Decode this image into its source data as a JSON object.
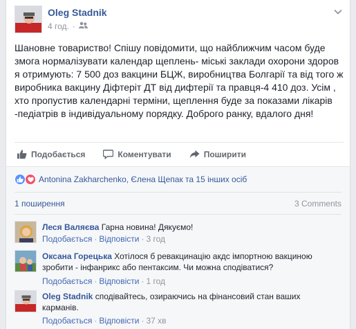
{
  "post": {
    "author": "Oleg Stadnik",
    "time": "4 год.",
    "separator": "·",
    "text": "Шановне товариство! Спішу повідомити, що найближчим часом буде змога нормалізувати календар щеплень- міські заклади охорони здоров я отримують: 7 500 доз вакцини БЦЖ, виробництва Болгарії та від того ж виробника вакцину Діфтеріт ДТ від дифтерії та правця-4 410 доз. Усім , хто пропустив календарні терміни, щеплення буде за показами лікарів -педіатрів в індивідуальному порядку. Доброго ранку, вдалого дня!",
    "actions": {
      "like": "Подобається",
      "comment": "Коментувати",
      "share": "Поширити"
    }
  },
  "ufi": {
    "reactions_text": "Antonina Zakharchenko, Єлена Щепак та 15 інших осіб",
    "shares_text": "1 поширення",
    "comments_count": "3 Comments"
  },
  "comments": [
    {
      "author": "Леся Валяєва",
      "text": "Гарна новина! Дякуємо!",
      "like": "Подобається",
      "reply": "Відповісти",
      "time": "3 год"
    },
    {
      "author": "Оксана Горецька",
      "text": "Хотілося б ревакцинацію акдс імпортною вакциною зробити - інфанрикс або пентаксим. Чи можна сподіватися?",
      "like": "Подобається",
      "reply": "Відповісти",
      "time": "1 год"
    },
    {
      "author": "Oleg Stadnik",
      "text": "сподівайтесь, озираючись на фінансовий стан ваших карманів.",
      "like": "Подобається",
      "reply": "Відповісти",
      "time": "37 хв"
    }
  ],
  "colors": {
    "link": "#365899",
    "muted": "#90949c",
    "background": "#e9ebee",
    "ufi_background": "#f6f7f9"
  }
}
